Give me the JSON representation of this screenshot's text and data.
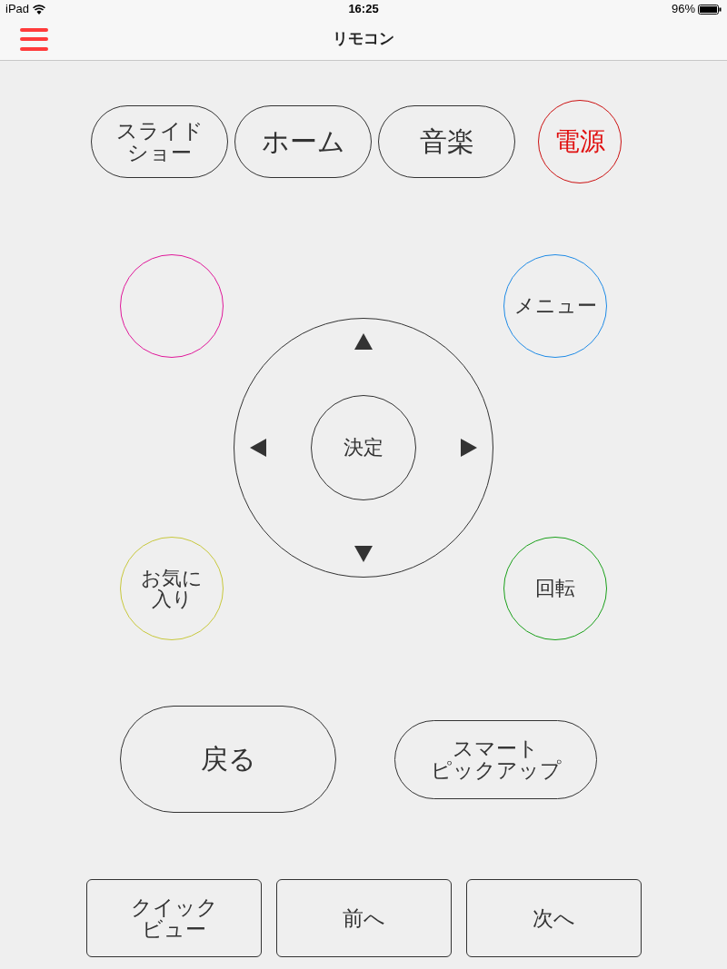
{
  "status_bar": {
    "device": "iPad",
    "time": "16:25",
    "battery": "96%"
  },
  "nav_bar": {
    "title": "リモコン"
  },
  "top_row": [
    {
      "lines": [
        "スライド",
        "ショー"
      ],
      "kind": "pill"
    },
    {
      "lines": [
        "ホーム"
      ],
      "kind": "pill"
    },
    {
      "lines": [
        "音楽"
      ],
      "kind": "pill"
    },
    {
      "lines": [
        "電源"
      ],
      "kind": "circle",
      "color": "#cc1111"
    }
  ],
  "color_buttons": [
    {
      "kind": "circle",
      "color": "#e0189a"
    },
    {
      "lines": [
        "メニュー"
      ],
      "kind": "circle",
      "color": "#1f8be6"
    },
    {
      "lines": [
        "お気に",
        "入り"
      ],
      "kind": "circle",
      "color": "#c8c83c"
    },
    {
      "lines": [
        "回転"
      ],
      "kind": "circle",
      "color": "#1aa01a"
    }
  ],
  "dpad": {
    "center": "決定"
  },
  "middle_row": [
    {
      "lines": [
        "戻る"
      ],
      "kind": "big"
    },
    {
      "lines": [
        "スマート",
        "ピックアップ"
      ],
      "kind": "pill"
    }
  ],
  "bottom_row": [
    {
      "lines": [
        "クイック",
        "ビュー"
      ]
    },
    {
      "lines": [
        "前へ"
      ]
    },
    {
      "lines": [
        "次へ"
      ]
    }
  ]
}
